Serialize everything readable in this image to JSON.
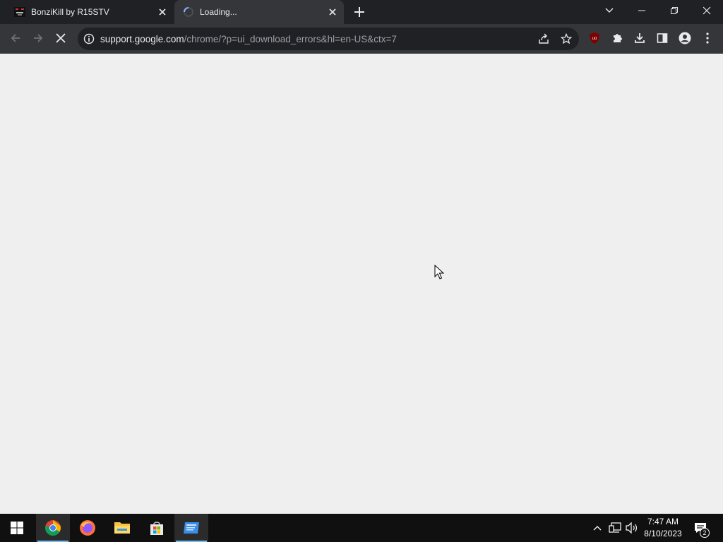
{
  "browser": {
    "tabs": [
      {
        "title": "BonziKill by R15STV",
        "favicon": "bonzikill-favicon",
        "active": false
      },
      {
        "title": "Loading...",
        "favicon": "loading-spinner",
        "active": true
      }
    ],
    "address_bar": {
      "host": "support.google.com",
      "path": "/chrome/?p=ui_download_errors&hl=en-US&ctx=7"
    },
    "extension_badge": "uo"
  },
  "page": {
    "state": "loading"
  },
  "taskbar": {
    "pinned_apps": [
      "windows-start",
      "google-chrome",
      "firefox",
      "file-explorer",
      "microsoft-store",
      "app-window"
    ],
    "clock": {
      "time": "7:47 AM",
      "date": "8/10/2023"
    },
    "notification_count": "2"
  },
  "colors": {
    "tabstrip_bg": "#202124",
    "toolbar_bg": "#35363a",
    "omnibox_bg": "#202124",
    "content_bg": "#efefef",
    "taskbar_bg": "#101010",
    "ublock_red": "#800000",
    "accent_blue": "#76b9ed"
  }
}
